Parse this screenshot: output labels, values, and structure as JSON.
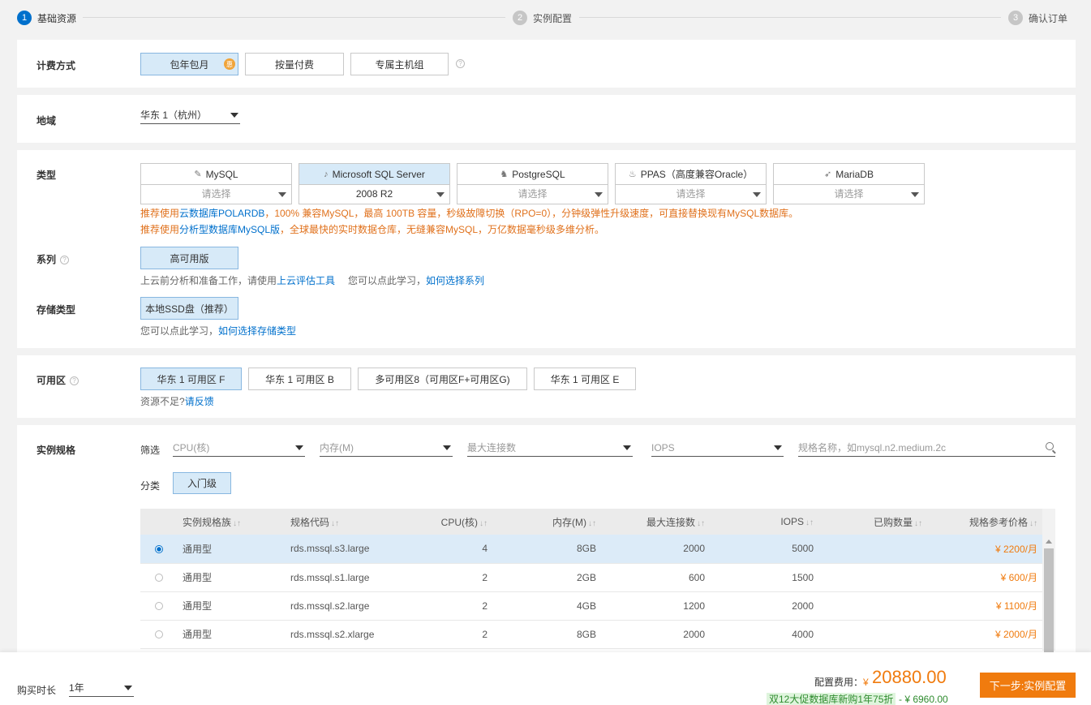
{
  "steps": [
    {
      "num": "1",
      "label": "基础资源"
    },
    {
      "num": "2",
      "label": "实例配置"
    },
    {
      "num": "3",
      "label": "确认订单"
    }
  ],
  "billing": {
    "label": "计费方式",
    "options": [
      "包年包月",
      "按量付费",
      "专属主机组"
    ],
    "badge": "惠",
    "selected": "包年包月"
  },
  "region": {
    "label": "地域",
    "value": "华东 1（杭州）"
  },
  "type": {
    "label": "类型",
    "engines": [
      {
        "name": "MySQL",
        "icon": "mysql-icon",
        "glyph": "✎",
        "version": "请选择"
      },
      {
        "name": "Microsoft SQL Server",
        "icon": "sqlserver-icon",
        "glyph": "♪",
        "version": "2008 R2"
      },
      {
        "name": "PostgreSQL",
        "icon": "postgresql-icon",
        "glyph": "♞",
        "version": "请选择"
      },
      {
        "name": "PPAS（高度兼容Oracle）",
        "icon": "ppas-icon",
        "glyph": "♨",
        "version": "请选择"
      },
      {
        "name": "MariaDB",
        "icon": "mariadb-icon",
        "glyph": "➶",
        "version": "请选择"
      }
    ],
    "note1_pre": "推荐使用",
    "note1_link": "云数据库POLARDB",
    "note1_post": "，100% 兼容MySQL，最高 100TB 容量，秒级故障切换（RPO=0），分钟级弹性升级速度，可直接替换现有MySQL数据库。",
    "note2_pre": "推荐使用",
    "note2_link": "分析型数据库MySQL版",
    "note2_post": "，全球最快的实时数据仓库，无缝兼容MySQL，万亿数据毫秒级多维分析。"
  },
  "series": {
    "label": "系列",
    "option": "高可用版",
    "hint_pre": "上云前分析和准备工作，请使用",
    "hint_link1": "上云评估工具",
    "hint_mid": "您可以点此学习，",
    "hint_link2": "如何选择系列"
  },
  "storage": {
    "label": "存储类型",
    "option": "本地SSD盘（推荐）",
    "hint_pre": "您可以点此学习，",
    "hint_link": "如何选择存储类型"
  },
  "zone": {
    "label": "可用区",
    "options": [
      "华东 1 可用区 F",
      "华东 1 可用区 B",
      "多可用区8（可用区F+可用区G)",
      "华东 1 可用区 E"
    ],
    "hint_pre": "资源不足?",
    "hint_link": "请反馈"
  },
  "spec": {
    "label": "实例规格",
    "filter_label": "筛选",
    "filters": {
      "cpu": "CPU(核)",
      "mem": "内存(M)",
      "conn": "最大连接数",
      "iops": "IOPS",
      "search_placeholder": "规格名称，如mysql.n2.medium.2c"
    },
    "category_label": "分类",
    "category_option": "入门级",
    "columns": [
      "实例规格族",
      "规格代码",
      "CPU(核)",
      "内存(M)",
      "最大连接数",
      "IOPS",
      "已购数量",
      "规格参考价格"
    ],
    "rows": [
      {
        "family": "通用型",
        "code": "rds.mssql.s3.large",
        "cpu": "4",
        "mem": "8GB",
        "conn": "2000",
        "iops": "5000",
        "bought": "",
        "price": "¥ 2200/月",
        "selected": true
      },
      {
        "family": "通用型",
        "code": "rds.mssql.s1.large",
        "cpu": "2",
        "mem": "2GB",
        "conn": "600",
        "iops": "1500",
        "bought": "",
        "price": "¥ 600/月",
        "selected": false
      },
      {
        "family": "通用型",
        "code": "rds.mssql.s2.large",
        "cpu": "2",
        "mem": "4GB",
        "conn": "1200",
        "iops": "2000",
        "bought": "",
        "price": "¥ 1100/月",
        "selected": false
      },
      {
        "family": "通用型",
        "code": "rds.mssql.s2.xlarge",
        "cpu": "2",
        "mem": "8GB",
        "conn": "2000",
        "iops": "4000",
        "bought": "",
        "price": "¥ 2000/月",
        "selected": false
      }
    ]
  },
  "footer": {
    "duration_label": "购买时长",
    "duration_value": "1年",
    "fee_label": "配置费用：",
    "currency": "¥",
    "fee_value": "20880.00",
    "promo": "双12大促数据库新购1年75折",
    "promo_amount": "- ¥ 6960.00",
    "next_button": "下一步:实例配置"
  },
  "colors": {
    "accent": "#0070cc",
    "price": "#f07b0e",
    "selected_bg": "#d7eaf8"
  }
}
